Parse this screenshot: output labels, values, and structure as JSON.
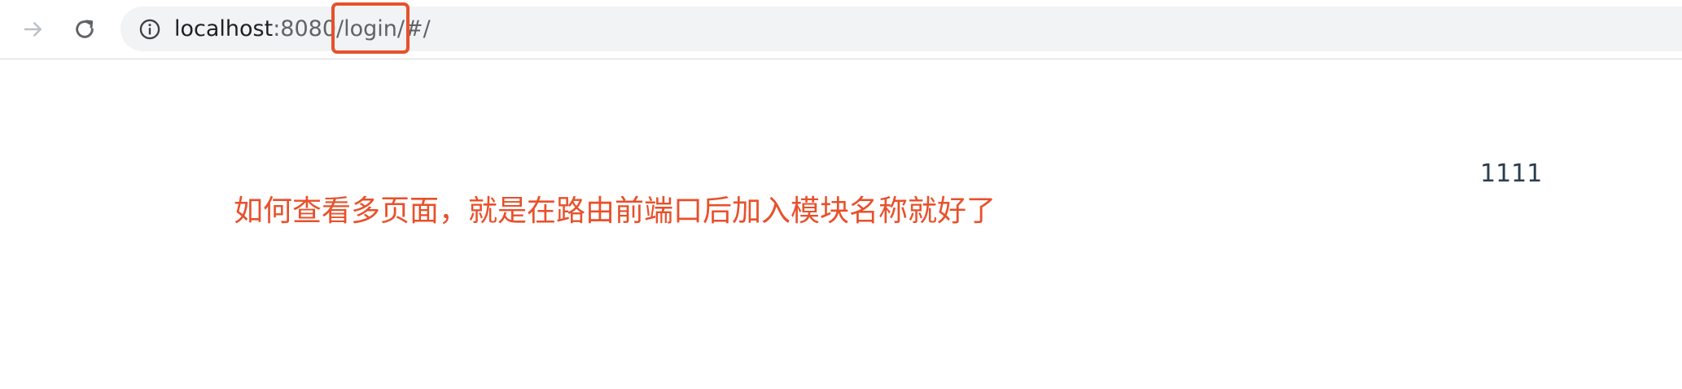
{
  "browser": {
    "url_host": "localhost",
    "url_rest": ":8080/login/#/"
  },
  "page": {
    "number_text": "1111"
  },
  "annotation": {
    "text": "如何查看多页面，就是在路由前端口后加入模块名称就好了",
    "color": "#e8502b"
  },
  "icons": {
    "forward": "arrow-right-icon",
    "reload": "reload-icon",
    "info": "info-icon"
  }
}
